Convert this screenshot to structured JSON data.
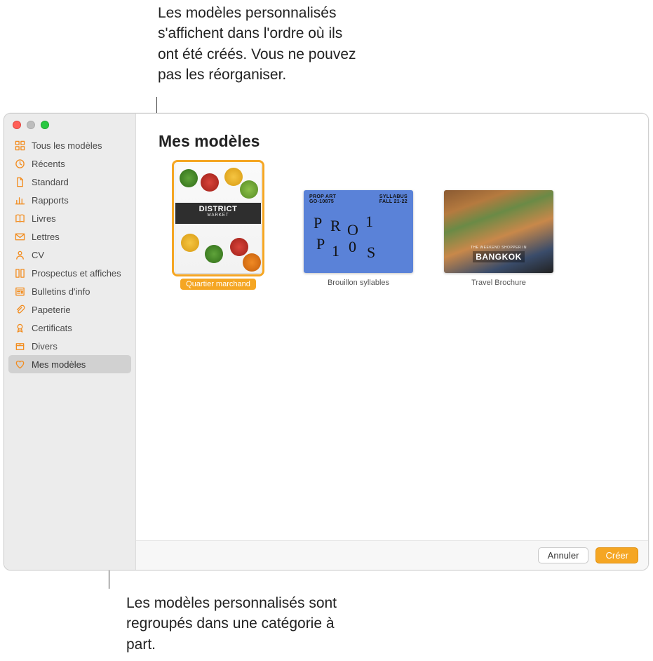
{
  "callouts": {
    "top": "Les modèles personnalisés s'affichent dans l'ordre où ils ont été créés. Vous ne pouvez pas les réorganiser.",
    "bottom": "Les modèles personnalisés sont regroupés dans une catégorie à part."
  },
  "sidebar": {
    "items": [
      {
        "icon": "grid",
        "label": "Tous les modèles",
        "selected": false
      },
      {
        "icon": "clock",
        "label": "Récents",
        "selected": false
      },
      {
        "icon": "doc",
        "label": "Standard",
        "selected": false
      },
      {
        "icon": "chart",
        "label": "Rapports",
        "selected": false
      },
      {
        "icon": "book",
        "label": "Livres",
        "selected": false
      },
      {
        "icon": "envelope",
        "label": "Lettres",
        "selected": false
      },
      {
        "icon": "person",
        "label": "CV",
        "selected": false
      },
      {
        "icon": "columns",
        "label": "Prospectus et affiches",
        "selected": false
      },
      {
        "icon": "newspaper",
        "label": "Bulletins d'info",
        "selected": false
      },
      {
        "icon": "paperclip",
        "label": "Papeterie",
        "selected": false
      },
      {
        "icon": "ribbon",
        "label": "Certificats",
        "selected": false
      },
      {
        "icon": "box",
        "label": "Divers",
        "selected": false
      },
      {
        "icon": "heart",
        "label": "Mes modèles",
        "selected": true
      }
    ]
  },
  "main": {
    "title": "Mes modèles",
    "templates": [
      {
        "label": "Quartier marchand",
        "selected": true,
        "orientation": "portrait",
        "thumb": {
          "kind": "district",
          "banner_big": "DISTRICT",
          "banner_small": "MARKET"
        }
      },
      {
        "label": "Brouillon syllables",
        "selected": false,
        "orientation": "landscape",
        "thumb": {
          "kind": "props",
          "hdr_left": "PROP ART\nGO-10875",
          "hdr_right": "SYLLABUS\nFALL 21-22",
          "letters": [
            "P",
            "R",
            "O",
            "1",
            "P",
            "1",
            "0",
            "S"
          ]
        }
      },
      {
        "label": "Travel Brochure",
        "selected": false,
        "orientation": "landscape",
        "thumb": {
          "kind": "bangkok",
          "overlay_small": "THE WEEKEND SHOPPER IN",
          "overlay_big": "BANGKOK"
        }
      }
    ]
  },
  "footer": {
    "cancel": "Annuler",
    "create": "Créer"
  },
  "colors": {
    "accent": "#f5a623",
    "sidebar_icon": "#f28c1e"
  }
}
